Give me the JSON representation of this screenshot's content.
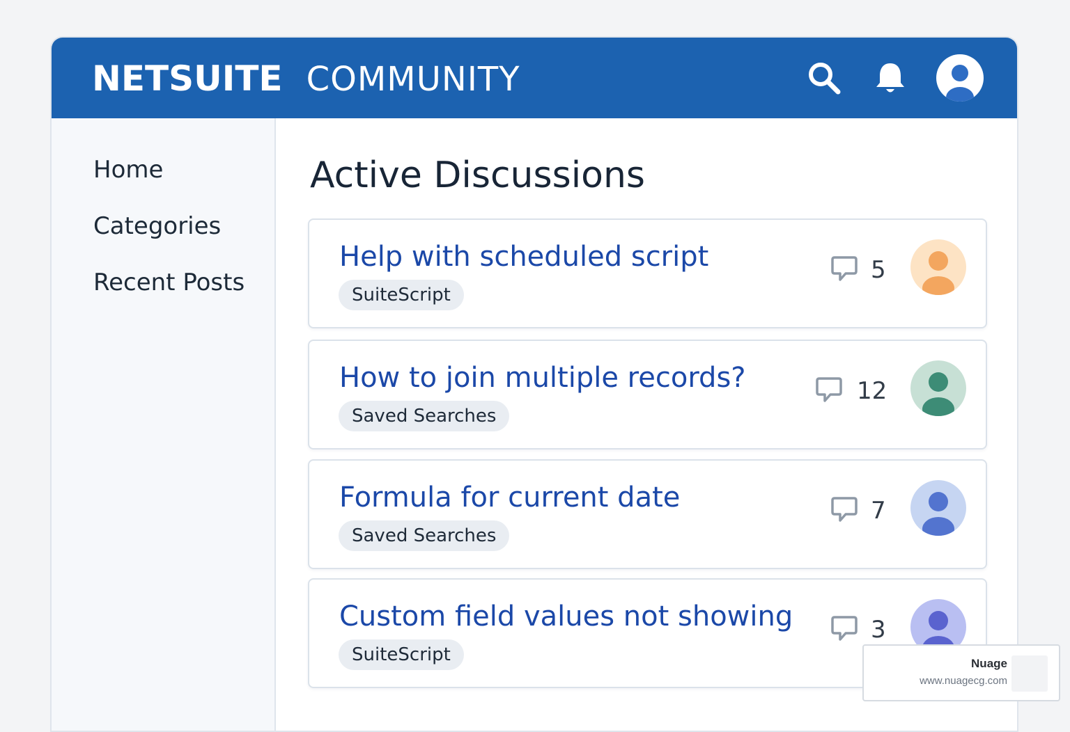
{
  "header": {
    "brand_primary": "NETSUITE",
    "brand_secondary": "COMMUNITY",
    "bar_color": "#1c62b0",
    "icons": [
      "search-icon",
      "bell-icon",
      "user-avatar-icon"
    ]
  },
  "sidebar": {
    "items": [
      {
        "label": "Home"
      },
      {
        "label": "Categories"
      },
      {
        "label": "Recent Posts"
      }
    ]
  },
  "main": {
    "title": "Active Discussions",
    "discussions": [
      {
        "title": "Help with scheduled script",
        "tag": "SuiteScript",
        "comments": "5",
        "avatar_bg": "#fde3c4",
        "avatar_fg": "#f3a65f",
        "icon": "comment-icon"
      },
      {
        "title": "How to join multiple records?",
        "tag": "Saved Searches",
        "comments": "12",
        "avatar_bg": "#c7e0d5",
        "avatar_fg": "#3d8c76",
        "icon": "comment-icon"
      },
      {
        "title": "Formula for current date",
        "tag": "Saved Searches",
        "comments": "7",
        "avatar_bg": "#c6d5f2",
        "avatar_fg": "#5374cf",
        "icon": "comment-icon"
      },
      {
        "title": "Custom field values not showing",
        "tag": "SuiteScript",
        "comments": "3",
        "avatar_bg": "#b9bff2",
        "avatar_fg": "#5a63cf",
        "icon": "comment-icon"
      }
    ]
  },
  "watermark": {
    "name": "Nuage",
    "url": "www.nuagecg.com"
  },
  "colors": {
    "accent": "#1c62b0",
    "link": "#1b48a8",
    "tag_bg": "#e9edf2"
  }
}
